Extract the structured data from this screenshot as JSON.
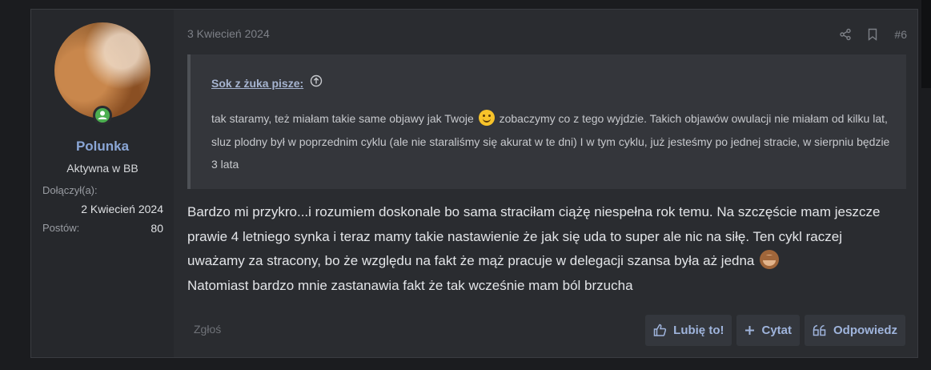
{
  "user": {
    "name": "Polunka",
    "title": "Aktywna w BB",
    "joined_label": "Dołączył(a):",
    "joined_value": "2 Kwiecień 2024",
    "posts_label": "Postów:",
    "posts_value": "80"
  },
  "post": {
    "date": "3 Kwiecień 2024",
    "number": "#6",
    "icons": [
      "share-icon",
      "bookmark-icon"
    ]
  },
  "quote": {
    "author": "Sok z żuka pisze:",
    "text_part1": "tak staramy, też miałam takie same objawy jak Twoje",
    "text_part2": "zobaczymy co z tego wyjdzie. Takich objawów owulacji nie miałam od kilku lat, sluz plodny był w poprzednim cyklu (ale nie staraliśmy się akurat w te dni) I w tym cyklu, już jesteśmy po jednej stracie, w sierpniu będzie 3 lata",
    "emoji": "smiling-face-emoji"
  },
  "message": {
    "text": "Bardzo mi przykro...i rozumiem doskonale bo sama straciłam ciążę niespełna rok temu. Na szczęście mam jeszcze prawie 4 letniego synka i teraz mamy takie nastawienie że jak się uda to super ale nic na siłę. Ten cykl raczej uważamy za stracony, bo że względu na fakt że mąż pracuje w delegacji szansa była aż jedna",
    "text_end": "Natomiast bardzo mnie zastanawia fakt że tak wcześnie mam ból brzucha",
    "emoji": "see-no-evil-monkey-emoji"
  },
  "footer": {
    "report": "Zgłoś",
    "like": "Lubię to!",
    "quote": "Cytat",
    "reply": "Odpowiedz"
  },
  "colors": {
    "accent": "#9fb4dc",
    "username": "#8aa6d6",
    "online": "#4caf50",
    "background": "#2a2c30"
  }
}
